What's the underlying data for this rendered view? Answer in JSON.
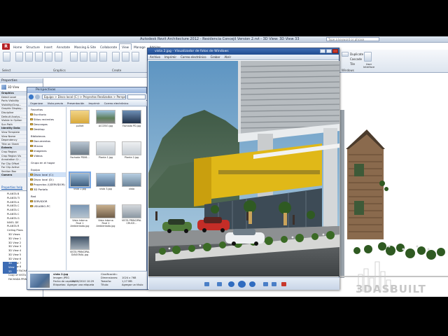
{
  "revit": {
    "title": "Autodesk Revit Architecture 2012 - Residencia Concejil Version 2.rvt - 3D View: 3D View 33",
    "search_placeholder": "Type a keyword or phrase",
    "app_button": "R",
    "tabs": [
      "Home",
      "Structure",
      "Insert",
      "Annotate",
      "Massing & Site",
      "Collaborate",
      "View",
      "Manage",
      "Add-Ins"
    ],
    "active_tab": "View",
    "ribbon_groups": [
      "Graphics",
      "Create",
      "Windows"
    ],
    "window_buttons": [
      "Duplicate",
      "Cascade",
      "Tile"
    ],
    "user_interface_label": "User Interface",
    "select_label": "Select"
  },
  "properties": {
    "title": "Properties",
    "view_type": "3D View",
    "rows": [
      {
        "label": "Graphics",
        "group": true
      },
      {
        "label": "Detail Level",
        "group": false
      },
      {
        "label": "Parts Visibility",
        "group": false
      },
      {
        "label": "Visibility/Grap...",
        "group": false
      },
      {
        "label": "Graphic Display...",
        "group": false
      },
      {
        "label": "Discipline",
        "group": false
      },
      {
        "label": "Default Analys...",
        "group": false
      },
      {
        "label": "Visible In Option",
        "group": false
      },
      {
        "label": "Sun Path",
        "group": false
      },
      {
        "label": "Identity Data",
        "group": true
      },
      {
        "label": "View Template",
        "group": false
      },
      {
        "label": "View Name",
        "group": false
      },
      {
        "label": "Dependency",
        "group": false
      },
      {
        "label": "Title on Sheet",
        "group": false
      },
      {
        "label": "Extents",
        "group": true
      },
      {
        "label": "Crop Region",
        "group": false
      },
      {
        "label": "Crop Region Vis",
        "group": false
      },
      {
        "label": "Annotation Cr...",
        "group": false
      },
      {
        "label": "Far Clip Offset",
        "group": false
      },
      {
        "label": "Far Clip Active",
        "group": false
      },
      {
        "label": "Section Box",
        "group": false
      },
      {
        "label": "Camera",
        "group": true
      }
    ],
    "help_link": "Properties help"
  },
  "project_browser": {
    "items": [
      "PLANTA B",
      "PLANTA TI",
      "PLANTA A",
      "PLANTA C",
      "PLANTA C",
      "PLANTA C",
      "PLANTA G",
      "NIVEL DE",
      "PLANTA R",
      "Ceiling Plans",
      "3D Views",
      "3D View 1",
      "3D View 2",
      "3D View 3",
      "3D View 4",
      "3D View 5",
      "3D View 6",
      "3D View 7",
      "3D View 8",
      "Copy of FACHADA PRI",
      "Copy of VISTA CONJ",
      "FACHADA PRINCIPAL"
    ],
    "selected": "3D View 33"
  },
  "explorer": {
    "title": "Perspectivas",
    "path": "Equipo > Disco local (C:) > Proyectos Realizados > Perspectivas >",
    "toolbar": [
      "Organizar",
      "Vista previa",
      "Presentación",
      "Imprimir",
      "Correo electrónico"
    ],
    "nav": [
      {
        "label": "Favoritos",
        "header": true
      },
      {
        "label": "Escritorio",
        "header": false
      },
      {
        "label": "Sitios recientes",
        "header": false
      },
      {
        "label": "Descargas",
        "header": false
      },
      {
        "label": "Desktop",
        "header": false
      },
      {
        "label": "Bibliotecas",
        "header": true
      },
      {
        "label": "Documentos",
        "header": false
      },
      {
        "label": "Música",
        "header": false
      },
      {
        "label": "Imágenes",
        "header": false
      },
      {
        "label": "Vídeos",
        "header": false
      },
      {
        "label": "Grupo en el hogar",
        "header": true
      },
      {
        "label": "Equipo",
        "header": true
      },
      {
        "label": "Disco local (C:)",
        "header": false
      },
      {
        "label": "Disco local (D:)",
        "header": false
      },
      {
        "label": "Proyectos (\\\\SERVIDOR)",
        "header": false
      },
      {
        "label": "3D Portafo",
        "header": false
      },
      {
        "label": "Red",
        "header": true
      },
      {
        "label": "SERVIDOR",
        "header": false
      },
      {
        "label": "USUARIO-PC",
        "header": false
      }
    ],
    "thumbs": [
      "pulhet",
      "ACCESO.jpg",
      "Fachada PD.jpg",
      "Fachada PD06...",
      "Planta 1.jpg",
      "Planta 2.jpg",
      "vista 2.jpg",
      "vista 3.jpg",
      "vista",
      "Vista Interna Final 1 Ambientada.jpg",
      "Vista Interna Final 2 Ambientada.jpg",
      "VISTA PRINCIPAL CRUCE...",
      "VISTA PRINCIPAL DIAGONAL.jpg"
    ],
    "selected_thumb": "vista 2.jpg",
    "details": {
      "name": "vista 2.jpg",
      "type": "Imagen JPEG",
      "date_label": "Fecha de captura:",
      "date": "20/08/2010 10:29",
      "tags_label": "Etiquetas:",
      "tags": "Agregar una etiqueta",
      "rating_label": "Clasificación:",
      "dimensions_label": "Dimensiones:",
      "dimensions": "1024 x 768",
      "size_label": "Tamaño:",
      "size": "1,27 MB",
      "title_label": "Título:",
      "title": "Agregar un título"
    }
  },
  "viewer": {
    "title": "vista 2.jpg - Visualizador de fotos de Windows",
    "menu": [
      "Archivo",
      "Imprimir",
      "Correo electrónico",
      "Grabar",
      "Abrir"
    ]
  },
  "watermark": "3DASBUILT",
  "colors": {
    "revit_red": "#b51f24",
    "ribbon_blue": "#dde5ef",
    "viewer_title": "#1f4b90",
    "building_yellow": "#e0b818",
    "sky": "#7fb2d6"
  }
}
